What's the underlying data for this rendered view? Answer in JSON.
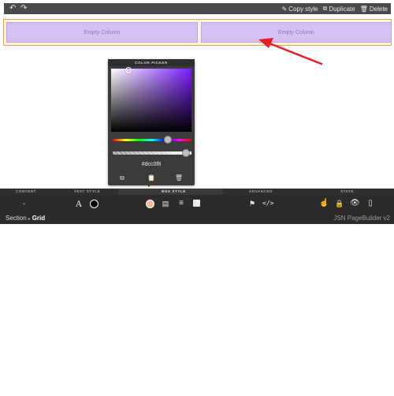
{
  "topbar": {
    "undo_icon": "undo-icon",
    "redo_icon": "redo-icon",
    "copy_style": "Copy style",
    "duplicate": "Duplicate",
    "delete": "Delete"
  },
  "grid": {
    "columns": [
      "Empty Column",
      "Empty Column"
    ]
  },
  "color_picker": {
    "title": "COLOR PICKER",
    "hex": "#dcc0f8",
    "hue_level": 0.7,
    "alpha_level": 1.0
  },
  "property_bar": {
    "sections": [
      "CONTENT",
      "TEXT STYLE",
      "BOX STYLE",
      "ADVANCED",
      "STATE"
    ],
    "active_section": "BOX STYLE",
    "content_value": "-",
    "breadcrumb": {
      "parent": "Section",
      "current": "Grid"
    },
    "brand": "JSN PageBuilder v2"
  },
  "colors": {
    "accent_orange": "#f2a23c",
    "column_purple": "#d6c1f4",
    "arrow_red": "#e5202a",
    "bar_bg": "#2b2b2b"
  }
}
